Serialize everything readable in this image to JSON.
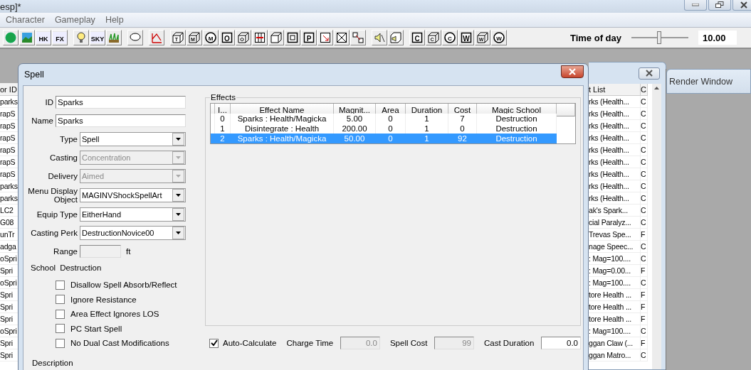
{
  "app_window": {
    "title": "esp]*"
  },
  "menu": [
    "Character",
    "Gameplay",
    "Help"
  ],
  "toolbar": {
    "groups": [
      [
        {
          "kind": "globe"
        },
        {
          "kind": "landscape"
        },
        {
          "kind": "text",
          "glyph": "HK"
        },
        {
          "kind": "text",
          "glyph": "FX"
        }
      ],
      [
        {
          "kind": "bulb"
        },
        {
          "kind": "text",
          "glyph": "SKY"
        },
        {
          "kind": "grass"
        }
      ],
      [
        {
          "kind": "bubble"
        }
      ],
      [
        {
          "kind": "graph"
        }
      ],
      [
        {
          "kind": "cube",
          "glyph": "T"
        },
        {
          "kind": "cube",
          "glyph": "M"
        },
        {
          "kind": "circle",
          "glyph": "M"
        },
        {
          "kind": "square",
          "glyph": "O"
        },
        {
          "kind": "cube",
          "glyph": "O"
        },
        {
          "kind": "cross-h"
        },
        {
          "kind": "cube"
        },
        {
          "kind": "square"
        },
        {
          "kind": "square",
          "glyph": "P"
        },
        {
          "kind": "arrow-square"
        },
        {
          "kind": "x-square"
        },
        {
          "kind": "link"
        }
      ],
      [
        {
          "kind": "speaker"
        },
        {
          "kind": "cube-speaker"
        }
      ],
      [
        {
          "kind": "square",
          "glyph": "C"
        },
        {
          "kind": "cube",
          "glyph": "C"
        },
        {
          "kind": "circle",
          "glyph": "C"
        },
        {
          "kind": "square",
          "glyph": "W"
        },
        {
          "kind": "cube",
          "glyph": "W"
        },
        {
          "kind": "circle",
          "glyph": "W"
        }
      ]
    ],
    "time_of_day": {
      "label": "Time of day",
      "level": 0.49,
      "value": "10.00"
    }
  },
  "object_list": {
    "column": "or ID",
    "rows": [
      "parks",
      "rapS",
      "rapS",
      "rapS",
      "rapS",
      "rapS",
      "rapS",
      "parks",
      "parks",
      "LC2",
      "G08",
      "unTr",
      "adga",
      "oSpri",
      "Spri",
      "oSpri",
      "Spri",
      "Spri",
      "Spri",
      "oSpri",
      "Spri",
      "Spri"
    ]
  },
  "spell_dialog": {
    "title": "Spell",
    "fields": [
      {
        "label": "ID",
        "kind": "text",
        "value": "Sparks",
        "disabled": false
      },
      {
        "label": "Name",
        "kind": "text",
        "value": "Sparks",
        "disabled": false
      },
      {
        "label": "Type",
        "kind": "select",
        "value": "Spell",
        "disabled": false
      },
      {
        "label": "Casting",
        "kind": "select",
        "value": "Concentration",
        "disabled": true
      },
      {
        "label": "Delivery",
        "kind": "select",
        "value": "Aimed",
        "disabled": true
      },
      {
        "label": "Menu Display Object",
        "kind": "select",
        "value": "MAGINVShockSpellArt",
        "disabled": false
      },
      {
        "label": "Equip Type",
        "kind": "select",
        "value": "EitherHand",
        "disabled": false
      },
      {
        "label": "Casting Perk",
        "kind": "select",
        "value": "DestructionNovice00",
        "disabled": false
      },
      {
        "label": "Range",
        "kind": "short",
        "unit": "ft",
        "disabled": true
      }
    ],
    "school": {
      "label": "School",
      "value": "Destruction"
    },
    "flags": [
      {
        "label": "Disallow Spell Absorb/Reflect",
        "checked": false
      },
      {
        "label": "Ignore Resistance",
        "checked": false
      },
      {
        "label": "Area Effect Ignores LOS",
        "checked": false
      },
      {
        "label": "PC Start Spell",
        "checked": false
      },
      {
        "label": "No Dual Cast Modifications",
        "checked": false
      }
    ],
    "description_label": "Description",
    "effects": {
      "title": "Effects",
      "columns": [
        "I...",
        "Effect Name",
        "Magnit...",
        "Area",
        "Duration",
        "Cost",
        "Magic School"
      ],
      "rows": [
        {
          "cells": [
            "0",
            "Sparks : Health/Magicka",
            "5.00",
            "0",
            "1",
            "7",
            "Destruction"
          ],
          "selected": false
        },
        {
          "cells": [
            "1",
            "Disintegrate : Health",
            "200.00",
            "0",
            "1",
            "0",
            "Destruction"
          ],
          "selected": false
        },
        {
          "cells": [
            "2",
            "Sparks : Health/Magicka",
            "50.00",
            "0",
            "1",
            "92",
            "Destruction"
          ],
          "selected": true
        }
      ]
    },
    "auto_calculate": {
      "label": "Auto-Calculate",
      "checked": true
    },
    "numbers": [
      {
        "label": "Charge Time",
        "value": "0.0",
        "disabled": true
      },
      {
        "label": "Spell Cost",
        "value": "99",
        "disabled": true
      },
      {
        "label": "Cast Duration",
        "value": "0.0",
        "disabled": false
      }
    ]
  },
  "effect_list": {
    "columns": [
      "t List",
      "C"
    ],
    "rows": [
      [
        "rks (Health...",
        "C"
      ],
      [
        "rks (Health...",
        "C"
      ],
      [
        "rks (Health...",
        "C"
      ],
      [
        "rks (Health...",
        "C"
      ],
      [
        "rks (Health...",
        "C"
      ],
      [
        "rks (Health...",
        "C"
      ],
      [
        "rks (Health...",
        "C"
      ],
      [
        "rks (Health...",
        "C"
      ],
      [
        "rks (Health...",
        "C"
      ],
      [
        "ak's Spark...",
        "C"
      ],
      [
        "cial Paralyz...",
        "C"
      ],
      [
        "Trevas Spe...",
        "F"
      ],
      [
        "nage Speec...",
        "C"
      ],
      [
        ": Mag=100....",
        "C"
      ],
      [
        ": Mag=0.00...",
        "F"
      ],
      [
        ": Mag=100....",
        "C"
      ],
      [
        "tore Health ...",
        "F"
      ],
      [
        "tore Health ...",
        "F"
      ],
      [
        "tore Health ...",
        "F"
      ],
      [
        ": Mag=100....",
        "C"
      ],
      [
        "ggan Claw (...",
        "F"
      ],
      [
        "ggan Matro...",
        "C"
      ]
    ]
  },
  "render_window": {
    "title": "Render Window"
  }
}
